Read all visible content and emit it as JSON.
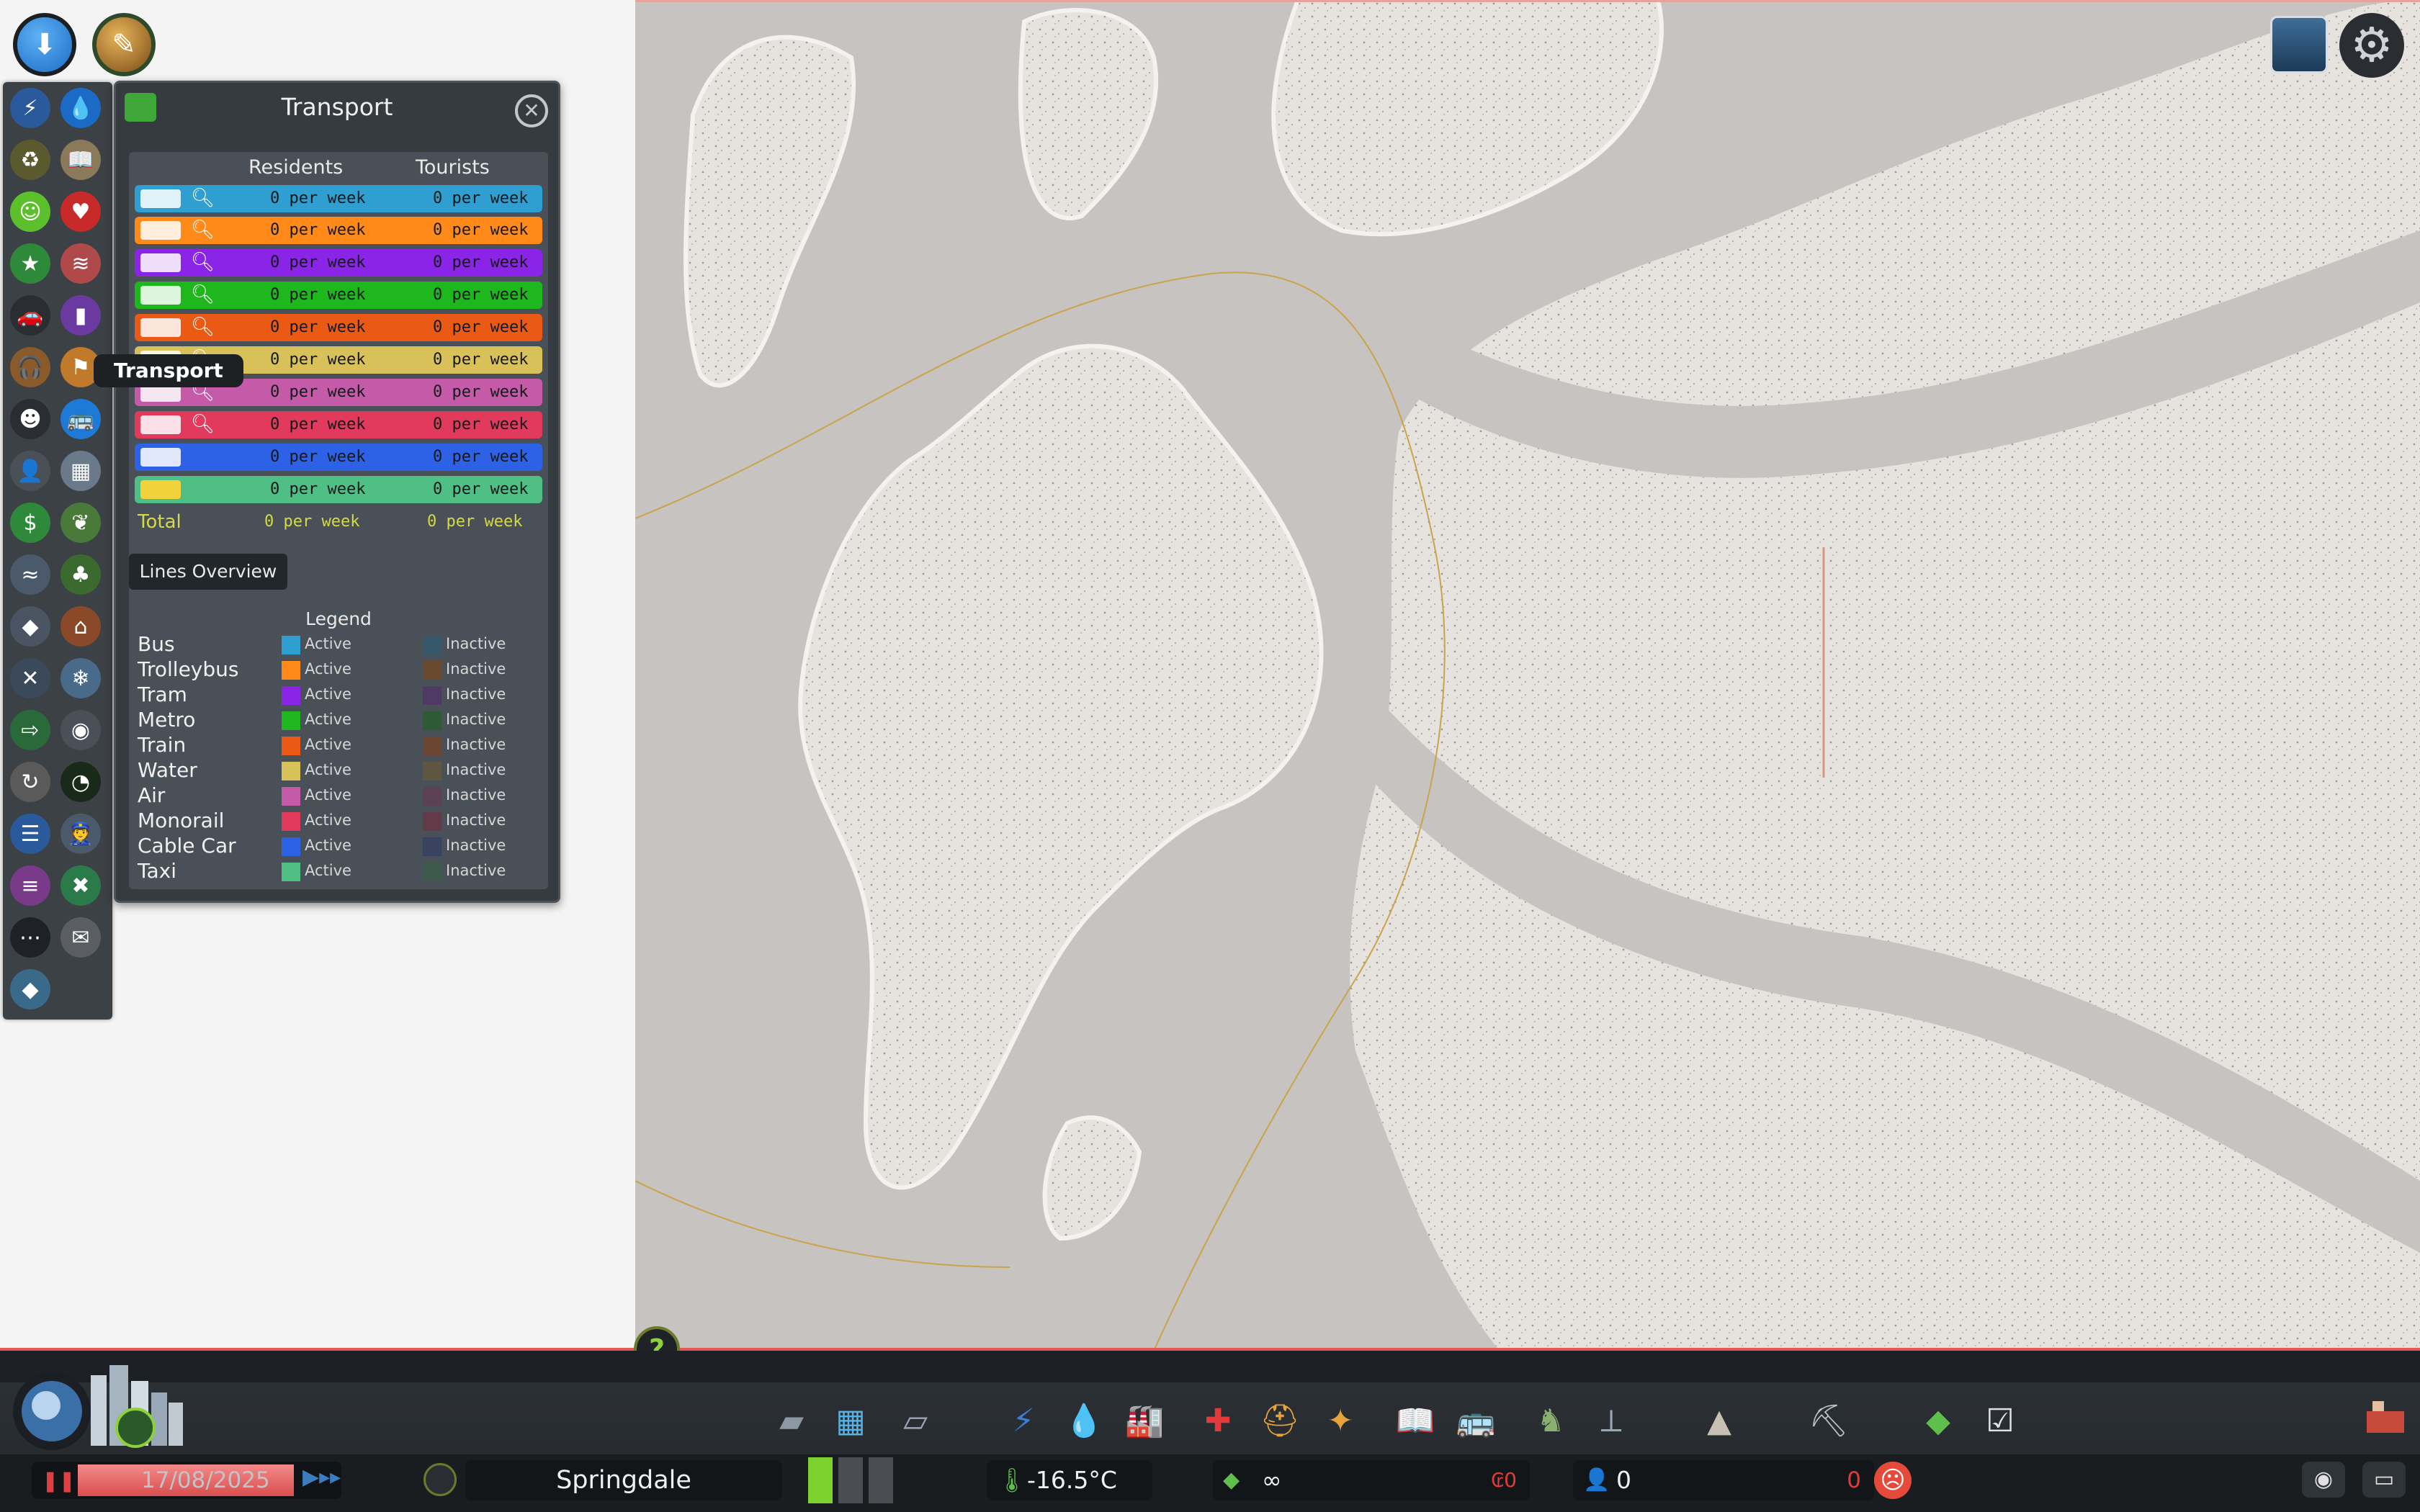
{
  "top_buttons": {
    "home_icon": "city-home-icon",
    "unlock_icon": "milestones-unlock-icon"
  },
  "sidebar": {
    "icons": [
      "electricity-icon",
      "water-icon",
      "garbage-icon",
      "education-icon",
      "happiness-icon",
      "health-icon",
      "fire-safety-icon",
      "wind-icon",
      "traffic-icon",
      "pollution-icon",
      "noise-icon",
      "crime-icon",
      "public-transport-icon",
      "bus-icon",
      "population-icon",
      "land-value-icon",
      "finances-icon",
      "natural-resources-icon",
      "fishing-icon",
      "parks-icon",
      "districts-icon",
      "buildings-level-icon",
      "maintenance-icon",
      "snow-icon",
      "road-routes-icon",
      "camera-icon",
      "tours-icon",
      "radio-icon",
      "escape-routes-icon",
      "police-icon",
      "heating-icon",
      "road-maintenance-icon",
      "post-icon",
      "mail-icon",
      "fish-icon"
    ],
    "tooltip": "Transport"
  },
  "panel": {
    "title": "Transport",
    "columns": {
      "residents": "Residents",
      "tourists": "Tourists"
    },
    "rows": [
      {
        "type": "Bus",
        "color": "#2f9ed0",
        "residents": "0 per week",
        "tourists": "0 per week"
      },
      {
        "type": "Trolleybus",
        "color": "#ff8a1a",
        "residents": "0 per week",
        "tourists": "0 per week"
      },
      {
        "type": "Tram",
        "color": "#8a24e6",
        "residents": "0 per week",
        "tourists": "0 per week"
      },
      {
        "type": "Metro",
        "color": "#1eb81e",
        "residents": "0 per week",
        "tourists": "0 per week"
      },
      {
        "type": "Train",
        "color": "#ea5a14",
        "residents": "0 per week",
        "tourists": "0 per week"
      },
      {
        "type": "Water",
        "color": "#d9c159",
        "residents": "0 per week",
        "tourists": "0 per week"
      },
      {
        "type": "Air",
        "color": "#c45aa8",
        "residents": "0 per week",
        "tourists": "0 per week"
      },
      {
        "type": "Monorail",
        "color": "#e23a5c",
        "residents": "0 per week",
        "tourists": "0 per week"
      },
      {
        "type": "Cable Car",
        "color": "#2e62e6",
        "residents": "0 per week",
        "tourists": "0 per week"
      },
      {
        "type": "Taxi",
        "color": "#4fbf86",
        "residents": "0 per week",
        "tourists": "0 per week"
      }
    ],
    "total": {
      "label": "Total",
      "residents": "0 per week",
      "tourists": "0 per week"
    },
    "lines_overview": "Lines Overview",
    "legend": {
      "title": "Legend",
      "active_label": "Active",
      "inactive_label": "Inactive",
      "items": [
        {
          "name": "Bus",
          "active": "#2f9ed0",
          "inactive": "#36586a"
        },
        {
          "name": "Trolleybus",
          "active": "#ff8a1a",
          "inactive": "#6a4a2e"
        },
        {
          "name": "Tram",
          "active": "#8a24e6",
          "inactive": "#4e3a64"
        },
        {
          "name": "Metro",
          "active": "#1eb81e",
          "inactive": "#2e5a34"
        },
        {
          "name": "Train",
          "active": "#ea5a14",
          "inactive": "#6a4632"
        },
        {
          "name": "Water",
          "active": "#d9c159",
          "inactive": "#5e5640"
        },
        {
          "name": "Air",
          "active": "#c45aa8",
          "inactive": "#5c4054"
        },
        {
          "name": "Monorail",
          "active": "#e23a5c",
          "inactive": "#643a48"
        },
        {
          "name": "Cable Car",
          "active": "#2e62e6",
          "inactive": "#3a4262"
        },
        {
          "name": "Taxi",
          "active": "#4fbf86",
          "inactive": "#3e5a4c"
        }
      ]
    }
  },
  "top_right": {
    "content_manager_icon": "paradox-cities-icon",
    "settings_icon": "gear-icon"
  },
  "help_icon": "help-icon",
  "bottom_bar": {
    "tools": [
      "roads-icon",
      "zoning-icon",
      "districts-icon",
      "electricity-icon",
      "water-icon",
      "garbage-icon",
      "health-icon",
      "fire-icon",
      "police-icon",
      "education-icon",
      "transport-icon",
      "parks-icon",
      "monuments-icon",
      "landscaping-icon",
      "terraforming-icon",
      "money-icon",
      "policies-icon"
    ],
    "date": "17/08/2025",
    "city_name": "Springdale",
    "temperature": "-16.5°C",
    "money": "∞",
    "income": "₢0",
    "population": "0",
    "population_change": "0",
    "happiness_icon": "sad-face-icon",
    "colors": {
      "paused": "#e24040",
      "negative": "#e23a3a",
      "demand_residential": "#7cd12c"
    }
  }
}
